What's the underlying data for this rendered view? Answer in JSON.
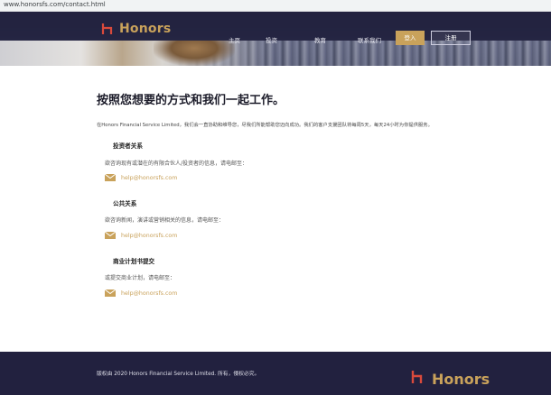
{
  "browser": {
    "url": "www.honorsfs.com/contact.html"
  },
  "header": {
    "brand": "Honors",
    "nav": [
      "主页",
      "投资",
      "教育",
      "联系我们"
    ],
    "login_label": "登入",
    "register_label": "注册"
  },
  "main": {
    "title": "按照您想要的方式和我们一起工作。",
    "intro": "在Honors Financial Service Limited，我们会一直协助和维导您，尽我们所能帮助您迈向成功。我们的客户支援团队将每周5天，每天24小时为你提供服务。",
    "sections": [
      {
        "title": "投资者关系",
        "desc": "欲咨询现有或潜在的有限合伙人/投资者的信息，请电邮至：",
        "email": "help@honorsfs.com"
      },
      {
        "title": "公共关系",
        "desc": "欲咨询新闻，演讲或营销相关的信息，请电邮至：",
        "email": "help@honorsfs.com"
      },
      {
        "title": "商业计划书提交",
        "desc": "或提交商业计划，请电邮至：",
        "email": "help@honorsfs.com"
      }
    ]
  },
  "footer": {
    "copyright": "版权由 2020 Honors Financial Service Limited. 所有，侵权必究。",
    "brand": "Honors"
  },
  "colors": {
    "accent": "#c9a25b",
    "nav_bg": "#21213e",
    "footer_bg": "#22213f",
    "logo_mark": "#d94a3c"
  },
  "icons": {
    "logo": "honors-logo-mark",
    "mail": "envelope-icon"
  }
}
